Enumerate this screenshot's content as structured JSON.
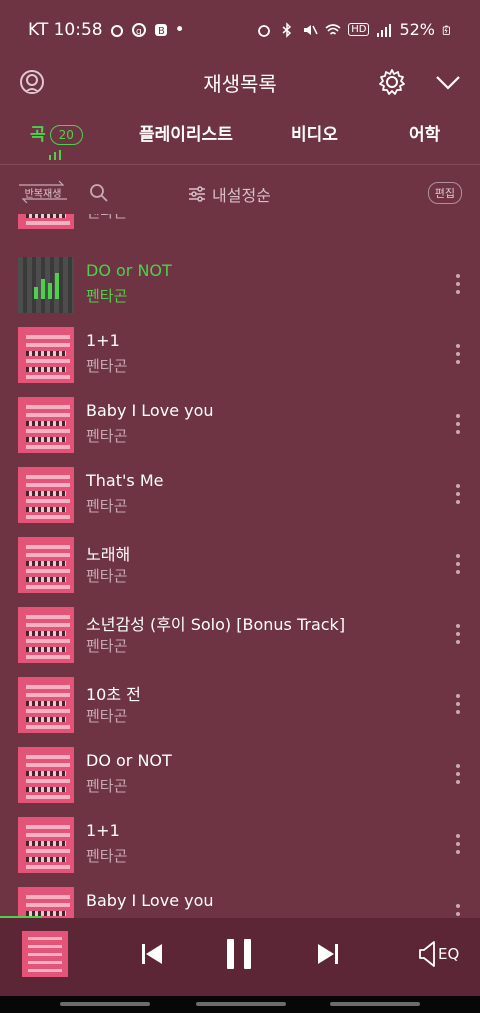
{
  "status_bar": {
    "carrier_time": "KT 10:58",
    "battery": "52%",
    "signal": "HD"
  },
  "header": {
    "title": "재생목록"
  },
  "tabs": [
    {
      "label": "곡",
      "count": "20"
    },
    {
      "label": "플레이리스트"
    },
    {
      "label": "비디오"
    },
    {
      "label": "어학"
    }
  ],
  "toolbar": {
    "repeat_label": "반복재생",
    "sort_label": "내설정순",
    "edit_label": "편집"
  },
  "tracks": [
    {
      "title": "",
      "artist": "펜타곤"
    },
    {
      "title": "DO or NOT",
      "artist": "펜타곤"
    },
    {
      "title": "1+1",
      "artist": "펜타곤"
    },
    {
      "title": "Baby I Love you",
      "artist": "펜타곤"
    },
    {
      "title": "That's Me",
      "artist": "펜타곤"
    },
    {
      "title": "노래해",
      "artist": "펜타곤"
    },
    {
      "title": "소년감성 (후이 Solo) [Bonus Track]",
      "artist": "펜타곤"
    },
    {
      "title": "10초 전",
      "artist": "펜타곤"
    },
    {
      "title": "DO or NOT",
      "artist": "펜타곤"
    },
    {
      "title": "1+1",
      "artist": "펜타곤"
    },
    {
      "title": "Baby I Love you",
      "artist": ""
    }
  ],
  "player": {
    "eq_label": "EQ"
  },
  "colors": {
    "background": "#6e3444",
    "accent": "#4ed04c",
    "player_bg": "#5c2636"
  }
}
